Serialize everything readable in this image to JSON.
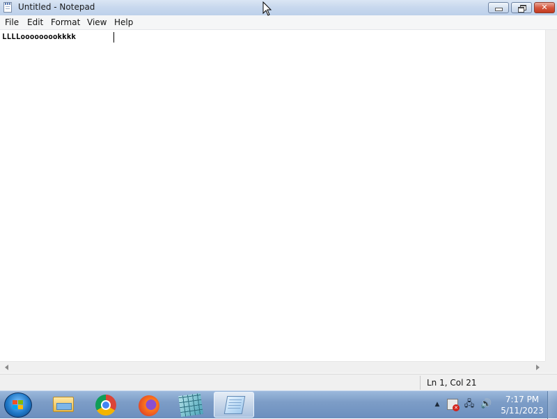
{
  "window": {
    "title": "Untitled - Notepad",
    "controls": {
      "minimize": "minimize",
      "maximize": "restore",
      "close": "✕"
    }
  },
  "menu": {
    "items": [
      "File",
      "Edit",
      "Format",
      "View",
      "Help"
    ]
  },
  "editor": {
    "content": "LLLLooooooookkkk"
  },
  "status": {
    "position": "Ln 1, Col 21"
  },
  "taskbar": {
    "apps": [
      {
        "name": "windows-explorer-icon",
        "active": false
      },
      {
        "name": "chrome-icon",
        "active": false
      },
      {
        "name": "firefox-icon",
        "active": false
      },
      {
        "name": "network-manager-icon",
        "active": false
      },
      {
        "name": "notepad-icon",
        "active": true
      }
    ],
    "tray": {
      "up_arrow": "▲",
      "network": "🖧",
      "volume": "🔊"
    },
    "clock": {
      "time": "7:17 PM",
      "date": "5/11/2023"
    }
  },
  "colors": {
    "taskbar": "#7d9dc7",
    "titlebar": "#c9d9ee",
    "close_button": "#c23b21"
  }
}
